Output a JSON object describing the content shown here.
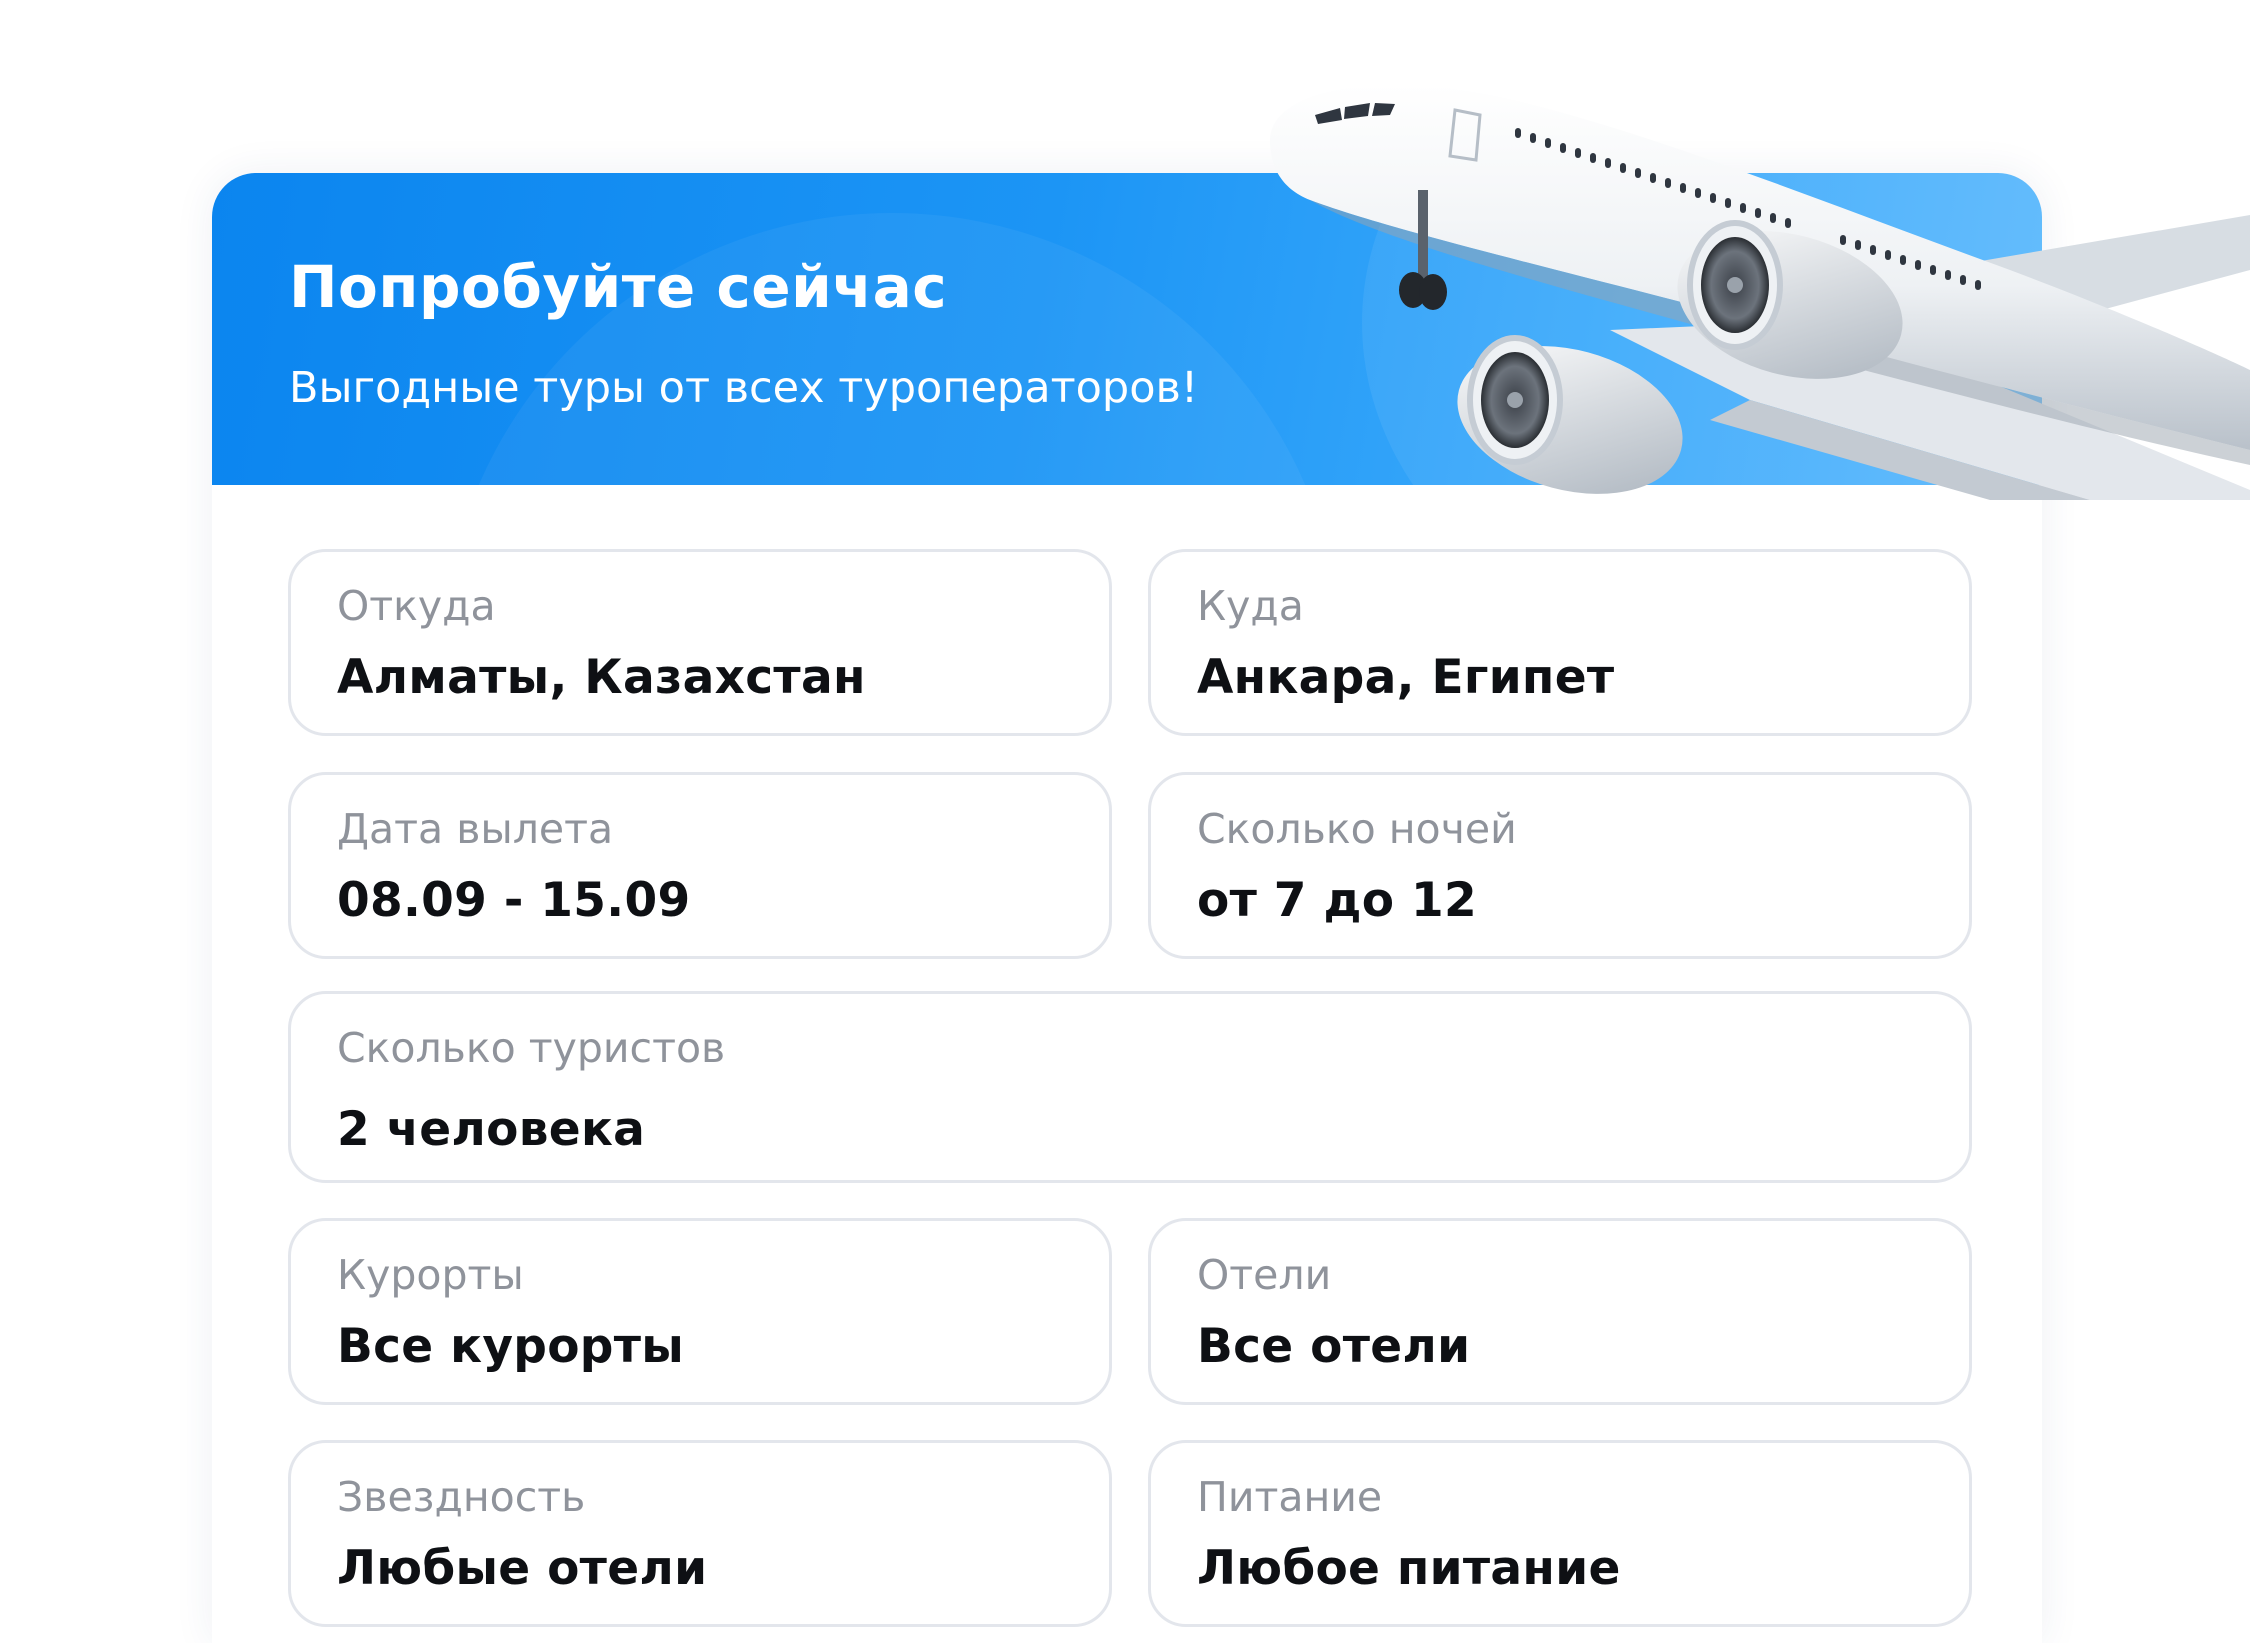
{
  "hero": {
    "title": "Попробуйте сейчас",
    "subtitle": "Выгодные туры от всех туроператоров!",
    "gradient_start": "#0b85ef",
    "gradient_end": "#5ab8fc",
    "image": "airplane-illustration"
  },
  "form": {
    "from": {
      "label": "Откуда",
      "value": "Алматы, Казахстан"
    },
    "to": {
      "label": "Куда",
      "value": "Анкара, Египет"
    },
    "date": {
      "label": "Дата вылета",
      "value": "08.09 - 15.09"
    },
    "nights": {
      "label": "Сколько ночей",
      "value": "от 7 до 12"
    },
    "tourists": {
      "label": "Сколько туристов",
      "value": "2 человека"
    },
    "resorts": {
      "label": "Курорты",
      "value": "Все курорты"
    },
    "hotels": {
      "label": "Отели",
      "value": "Все отели"
    },
    "stars": {
      "label": "Звездность",
      "value": "Любые отели"
    },
    "meals": {
      "label": "Питание",
      "value": "Любое питание"
    }
  },
  "colors": {
    "label_text": "#8f939b",
    "value_text": "#0e1014",
    "field_border": "#e3e6ec"
  }
}
